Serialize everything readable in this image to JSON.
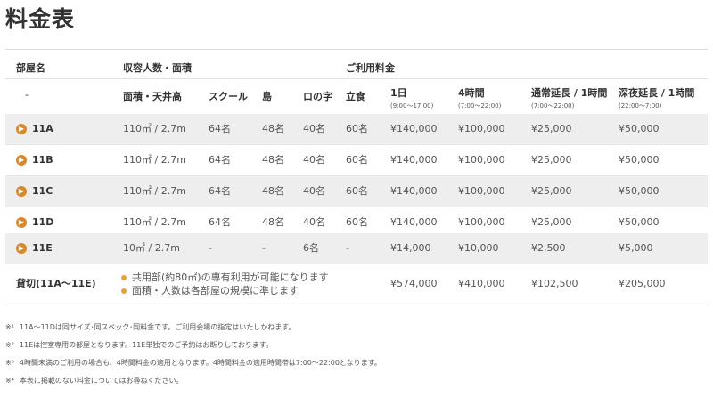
{
  "page_title": "料金表",
  "header": {
    "group_room": "部屋名",
    "group_capacity": "収容人数・面積",
    "group_fee": "ご利用料金",
    "room_placeholder": "-",
    "area": "面積・天井高",
    "school": "スクール",
    "island": "島",
    "u_shape": "ロの字",
    "standing": "立食",
    "day": "1日",
    "day_time": "(9:00～17:00)",
    "four_hours": "4時間",
    "four_hours_time": "(7:00～22:00)",
    "ext_normal": "通常延長 / 1時間",
    "ext_normal_time": "(7:00～22:00)",
    "ext_night": "深夜延長 / 1時間",
    "ext_night_time": "(22:00～7:00)"
  },
  "rows": [
    {
      "room": "11A",
      "area": "110㎡ / 2.7m",
      "school": "64名",
      "island": "48名",
      "u_shape": "40名",
      "standing": "60名",
      "day": "¥140,000",
      "four_hours": "¥100,000",
      "ext_normal": "¥25,000",
      "ext_night": "¥50,000"
    },
    {
      "room": "11B",
      "area": "110㎡ / 2.7m",
      "school": "64名",
      "island": "48名",
      "u_shape": "40名",
      "standing": "60名",
      "day": "¥140,000",
      "four_hours": "¥100,000",
      "ext_normal": "¥25,000",
      "ext_night": "¥50,000"
    },
    {
      "room": "11C",
      "area": "110㎡ / 2.7m",
      "school": "64名",
      "island": "48名",
      "u_shape": "40名",
      "standing": "60名",
      "day": "¥140,000",
      "four_hours": "¥100,000",
      "ext_normal": "¥25,000",
      "ext_night": "¥50,000"
    },
    {
      "room": "11D",
      "area": "110㎡ / 2.7m",
      "school": "64名",
      "island": "48名",
      "u_shape": "40名",
      "standing": "60名",
      "day": "¥140,000",
      "four_hours": "¥100,000",
      "ext_normal": "¥25,000",
      "ext_night": "¥50,000"
    },
    {
      "room": "11E",
      "area": "10㎡ / 2.7m",
      "school": "-",
      "island": "-",
      "u_shape": "6名",
      "standing": "-",
      "day": "¥14,000",
      "four_hours": "¥10,000",
      "ext_normal": "¥2,500",
      "ext_night": "¥5,000"
    }
  ],
  "kashikiri": {
    "label": "貸切(11A～11E)",
    "notes": [
      "共用部(約80㎡)の専有利用が可能になります",
      "面積・人数は各部屋の規模に準じます"
    ],
    "day": "¥574,000",
    "four_hours": "¥410,000",
    "ext_normal": "¥102,500",
    "ext_night": "¥205,000"
  },
  "footnotes": [
    {
      "mark": "※¹",
      "text": "11A～11Dは同サイズ･同スペック･同料金です。ご利用会場の指定はいたしかねます。"
    },
    {
      "mark": "※²",
      "text": "11Eは控室専用の部屋となります。11E単独でのご予約はお断りしております。"
    },
    {
      "mark": "※³",
      "text": "4時間未満のご利用の場合も、4時間料金の適用となります。4時間料金の適用時間帯は7:00～22:00となります。"
    },
    {
      "mark": "※⁴",
      "text": "本表に掲載のない料金についてはお尋ねください。"
    }
  ],
  "colors": {
    "accent": "#d8892b",
    "dot": "#e8a23a",
    "shaded_row": "#eeeeee"
  }
}
